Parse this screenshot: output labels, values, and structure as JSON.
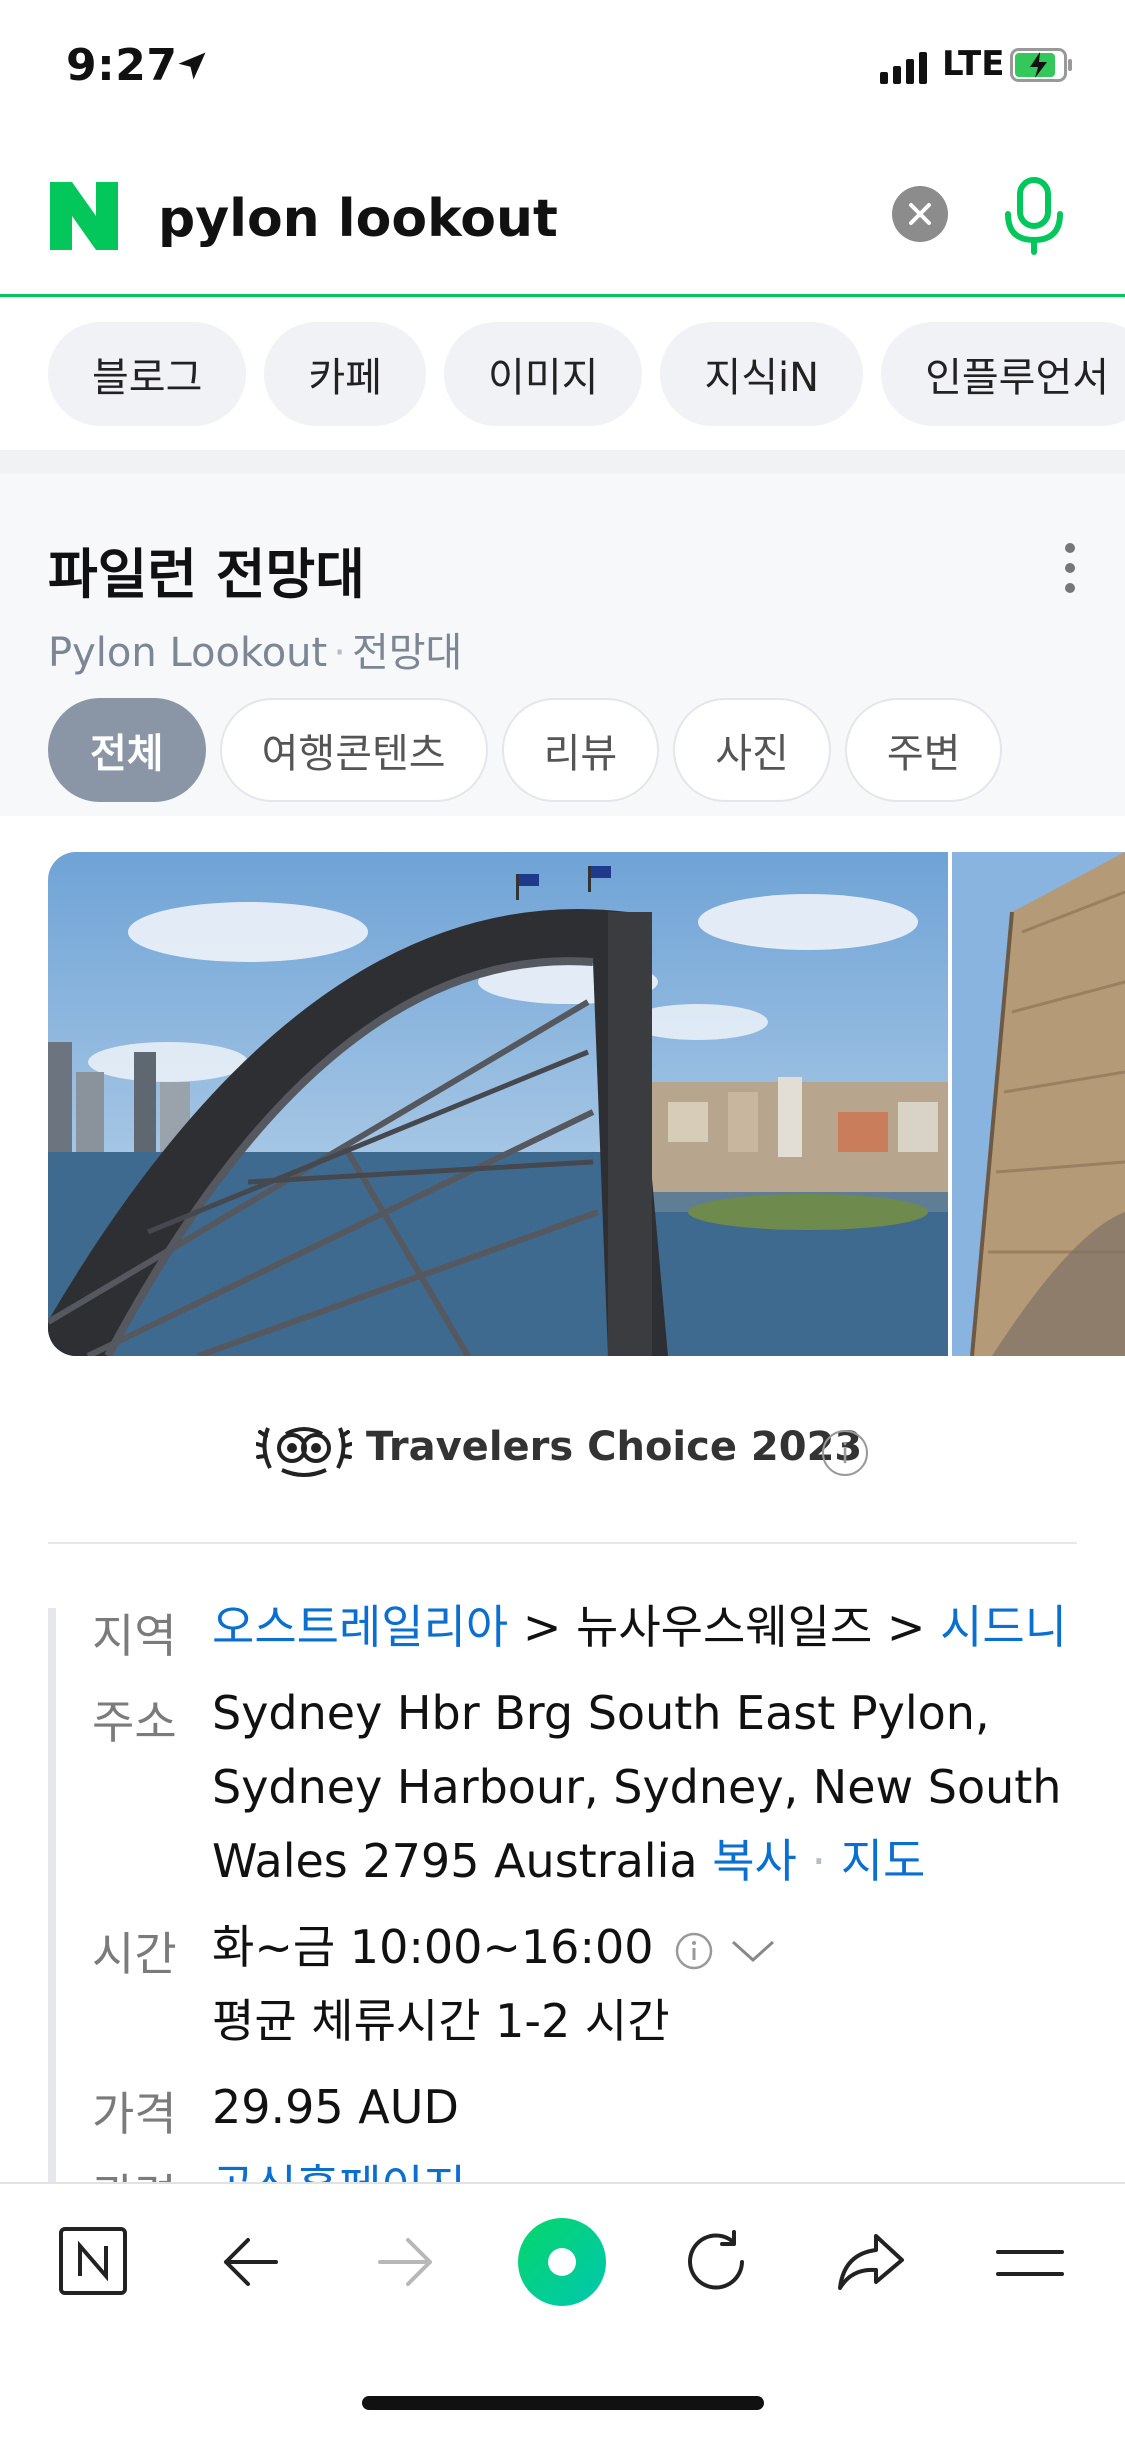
{
  "status_bar": {
    "time": "9:27",
    "network": "LTE"
  },
  "search": {
    "query": "pylon lookout"
  },
  "categories": [
    "블로그",
    "카페",
    "이미지",
    "지식iN",
    "인플루언서"
  ],
  "place": {
    "title": "파일런 전망대",
    "english_name": "Pylon Lookout",
    "category": "전망대",
    "tabs": [
      "전체",
      "여행콘텐츠",
      "리뷰",
      "사진",
      "주변"
    ],
    "award": "Travelers Choice 2023",
    "info": {
      "region_label": "지역",
      "region_country": "오스트레일리아",
      "region_state": "뉴사우스웨일즈",
      "region_city": "시드니",
      "address_label": "주소",
      "address_line1": "Sydney Hbr Brg South East Pylon,",
      "address_line2": "Sydney Harbour, Sydney, New South",
      "address_line3": "Wales 2795 Australia",
      "copy_link": "복사",
      "map_link": "지도",
      "hours_label": "시간",
      "hours": "화~금 10:00~16:00",
      "stay": "평균 체류시간 1-2 시간",
      "price_label": "가격",
      "price": "29.95 AUD",
      "related_label": "관련",
      "related_link": "공식홈페이지"
    }
  },
  "colors": {
    "naver_green": "#03c75a",
    "link_blue": "#0b6fd0",
    "active_tab": "#8a96a6"
  },
  "icons": {
    "toolbar": [
      "naver-home-icon",
      "back-arrow-icon",
      "forward-arrow-icon",
      "green-dot-icon",
      "refresh-icon",
      "share-icon",
      "menu-icon"
    ]
  }
}
